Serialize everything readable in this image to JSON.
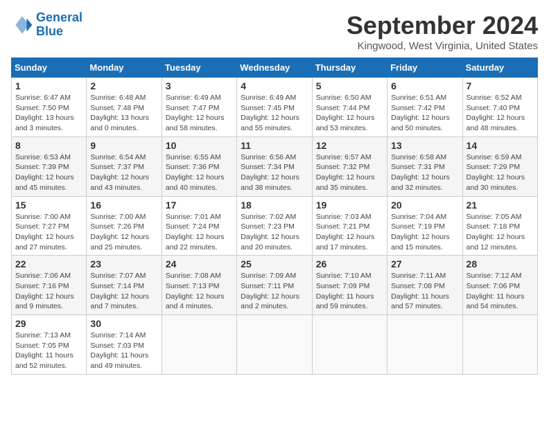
{
  "header": {
    "logo_line1": "General",
    "logo_line2": "Blue",
    "month_title": "September 2024",
    "location": "Kingwood, West Virginia, United States"
  },
  "calendar": {
    "days_of_week": [
      "Sunday",
      "Monday",
      "Tuesday",
      "Wednesday",
      "Thursday",
      "Friday",
      "Saturday"
    ],
    "weeks": [
      [
        null,
        {
          "day": "2",
          "info": "Sunrise: 6:48 AM\nSunset: 7:48 PM\nDaylight: 13 hours\nand 0 minutes."
        },
        {
          "day": "3",
          "info": "Sunrise: 6:49 AM\nSunset: 7:47 PM\nDaylight: 12 hours\nand 58 minutes."
        },
        {
          "day": "4",
          "info": "Sunrise: 6:49 AM\nSunset: 7:45 PM\nDaylight: 12 hours\nand 55 minutes."
        },
        {
          "day": "5",
          "info": "Sunrise: 6:50 AM\nSunset: 7:44 PM\nDaylight: 12 hours\nand 53 minutes."
        },
        {
          "day": "6",
          "info": "Sunrise: 6:51 AM\nSunset: 7:42 PM\nDaylight: 12 hours\nand 50 minutes."
        },
        {
          "day": "7",
          "info": "Sunrise: 6:52 AM\nSunset: 7:40 PM\nDaylight: 12 hours\nand 48 minutes."
        }
      ],
      [
        {
          "day": "1",
          "info": "Sunrise: 6:47 AM\nSunset: 7:50 PM\nDaylight: 13 hours\nand 3 minutes."
        },
        {
          "day": "9",
          "info": "Sunrise: 6:54 AM\nSunset: 7:37 PM\nDaylight: 12 hours\nand 43 minutes."
        },
        {
          "day": "10",
          "info": "Sunrise: 6:55 AM\nSunset: 7:36 PM\nDaylight: 12 hours\nand 40 minutes."
        },
        {
          "day": "11",
          "info": "Sunrise: 6:56 AM\nSunset: 7:34 PM\nDaylight: 12 hours\nand 38 minutes."
        },
        {
          "day": "12",
          "info": "Sunrise: 6:57 AM\nSunset: 7:32 PM\nDaylight: 12 hours\nand 35 minutes."
        },
        {
          "day": "13",
          "info": "Sunrise: 6:58 AM\nSunset: 7:31 PM\nDaylight: 12 hours\nand 32 minutes."
        },
        {
          "day": "14",
          "info": "Sunrise: 6:59 AM\nSunset: 7:29 PM\nDaylight: 12 hours\nand 30 minutes."
        }
      ],
      [
        {
          "day": "8",
          "info": "Sunrise: 6:53 AM\nSunset: 7:39 PM\nDaylight: 12 hours\nand 45 minutes."
        },
        {
          "day": "16",
          "info": "Sunrise: 7:00 AM\nSunset: 7:26 PM\nDaylight: 12 hours\nand 25 minutes."
        },
        {
          "day": "17",
          "info": "Sunrise: 7:01 AM\nSunset: 7:24 PM\nDaylight: 12 hours\nand 22 minutes."
        },
        {
          "day": "18",
          "info": "Sunrise: 7:02 AM\nSunset: 7:23 PM\nDaylight: 12 hours\nand 20 minutes."
        },
        {
          "day": "19",
          "info": "Sunrise: 7:03 AM\nSunset: 7:21 PM\nDaylight: 12 hours\nand 17 minutes."
        },
        {
          "day": "20",
          "info": "Sunrise: 7:04 AM\nSunset: 7:19 PM\nDaylight: 12 hours\nand 15 minutes."
        },
        {
          "day": "21",
          "info": "Sunrise: 7:05 AM\nSunset: 7:18 PM\nDaylight: 12 hours\nand 12 minutes."
        }
      ],
      [
        {
          "day": "15",
          "info": "Sunrise: 7:00 AM\nSunset: 7:27 PM\nDaylight: 12 hours\nand 27 minutes."
        },
        {
          "day": "23",
          "info": "Sunrise: 7:07 AM\nSunset: 7:14 PM\nDaylight: 12 hours\nand 7 minutes."
        },
        {
          "day": "24",
          "info": "Sunrise: 7:08 AM\nSunset: 7:13 PM\nDaylight: 12 hours\nand 4 minutes."
        },
        {
          "day": "25",
          "info": "Sunrise: 7:09 AM\nSunset: 7:11 PM\nDaylight: 12 hours\nand 2 minutes."
        },
        {
          "day": "26",
          "info": "Sunrise: 7:10 AM\nSunset: 7:09 PM\nDaylight: 11 hours\nand 59 minutes."
        },
        {
          "day": "27",
          "info": "Sunrise: 7:11 AM\nSunset: 7:08 PM\nDaylight: 11 hours\nand 57 minutes."
        },
        {
          "day": "28",
          "info": "Sunrise: 7:12 AM\nSunset: 7:06 PM\nDaylight: 11 hours\nand 54 minutes."
        }
      ],
      [
        {
          "day": "22",
          "info": "Sunrise: 7:06 AM\nSunset: 7:16 PM\nDaylight: 12 hours\nand 9 minutes."
        },
        {
          "day": "30",
          "info": "Sunrise: 7:14 AM\nSunset: 7:03 PM\nDaylight: 11 hours\nand 49 minutes."
        },
        null,
        null,
        null,
        null,
        null
      ],
      [
        {
          "day": "29",
          "info": "Sunrise: 7:13 AM\nSunset: 7:05 PM\nDaylight: 11 hours\nand 52 minutes."
        },
        null,
        null,
        null,
        null,
        null,
        null
      ]
    ]
  }
}
